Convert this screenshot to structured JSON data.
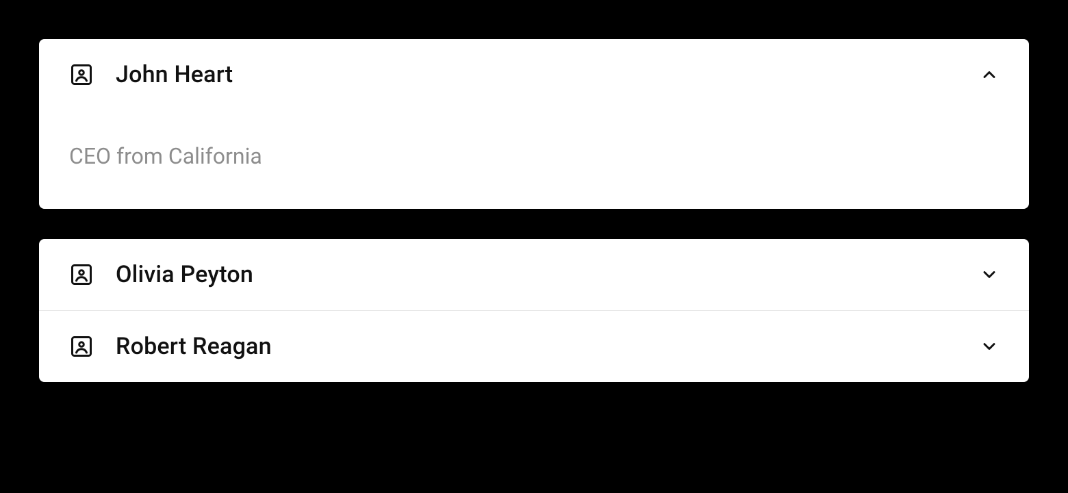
{
  "accordion": {
    "items": [
      {
        "name": "John Heart",
        "detail": "CEO from California",
        "expanded": true
      },
      {
        "name": "Olivia Peyton",
        "detail": "",
        "expanded": false
      },
      {
        "name": "Robert Reagan",
        "detail": "",
        "expanded": false
      }
    ]
  }
}
